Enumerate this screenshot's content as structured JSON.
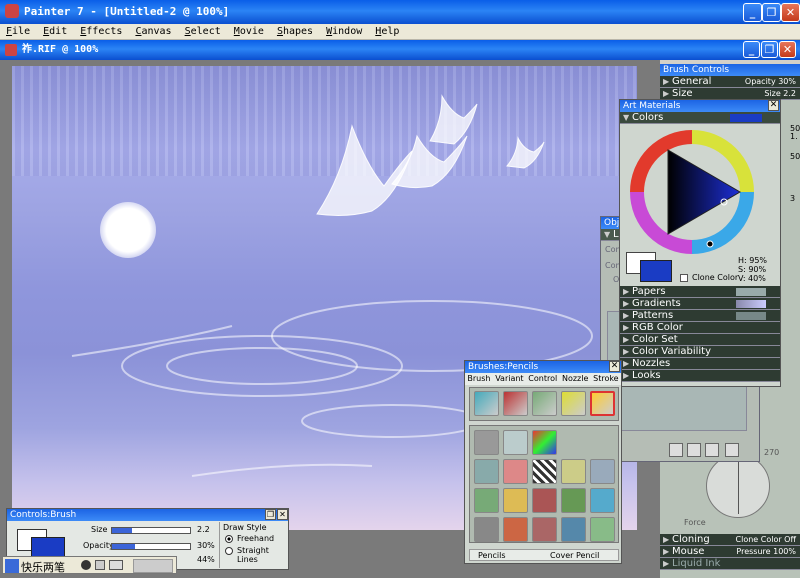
{
  "app": {
    "title": "Painter 7 - [Untitled-2 @ 100%]"
  },
  "menu": [
    "File",
    "Edit",
    "Effects",
    "Canvas",
    "Select",
    "Movie",
    "Shapes",
    "Window",
    "Help"
  ],
  "doc": {
    "title": "祚.RIF @ 100%"
  },
  "brush_controls": {
    "title": "Brush Controls",
    "rows": [
      {
        "label": "General",
        "value": "Opacity 30%"
      },
      {
        "label": "Size",
        "value": "Size 2.2"
      }
    ],
    "side_values": [
      "50",
      "1.",
      "50",
      "3"
    ]
  },
  "art_materials": {
    "title": "Art Materials",
    "colors_label": "Colors",
    "hsv": {
      "h": "H: 95%",
      "s": "S: 90%",
      "v": "V: 40%"
    },
    "clone_color": "Clone Color",
    "current_color": "#1a3cc4",
    "sections": [
      "Papers",
      "Gradients",
      "Patterns",
      "RGB Color",
      "Color Set",
      "Color Variability",
      "Nozzles",
      "Looks"
    ]
  },
  "objects": {
    "title": "Obje",
    "sub": "La",
    "labels": [
      "Com",
      "Com",
      "O"
    ]
  },
  "brushes": {
    "title": "Brushes:Pencils",
    "menu": [
      "Brush",
      "Variant",
      "Control",
      "Nozzle",
      "Stroke"
    ],
    "status_left": "Pencils",
    "status_right": "Cover Pencil"
  },
  "controls_brush": {
    "title": "Controls:Brush",
    "size_label": "Size",
    "size_value": "2.2",
    "size_fraction": 0.25,
    "opacity_label": "Opacity",
    "opacity_value": "30%",
    "opacity_fraction": 0.3,
    "third_value": "44%",
    "draw_style_label": "Draw Style",
    "freehand": "Freehand",
    "straight": "Straight Lines"
  },
  "right_lower": {
    "gauge_value": "270",
    "force_label": "Force",
    "rows": [
      {
        "label": "Cloning",
        "value": "Clone Color Off"
      },
      {
        "label": "Mouse",
        "value": "Pressure 100%"
      },
      {
        "label": "Liquid Ink",
        "value": ""
      }
    ]
  },
  "ime": {
    "label": "快乐两笔"
  }
}
